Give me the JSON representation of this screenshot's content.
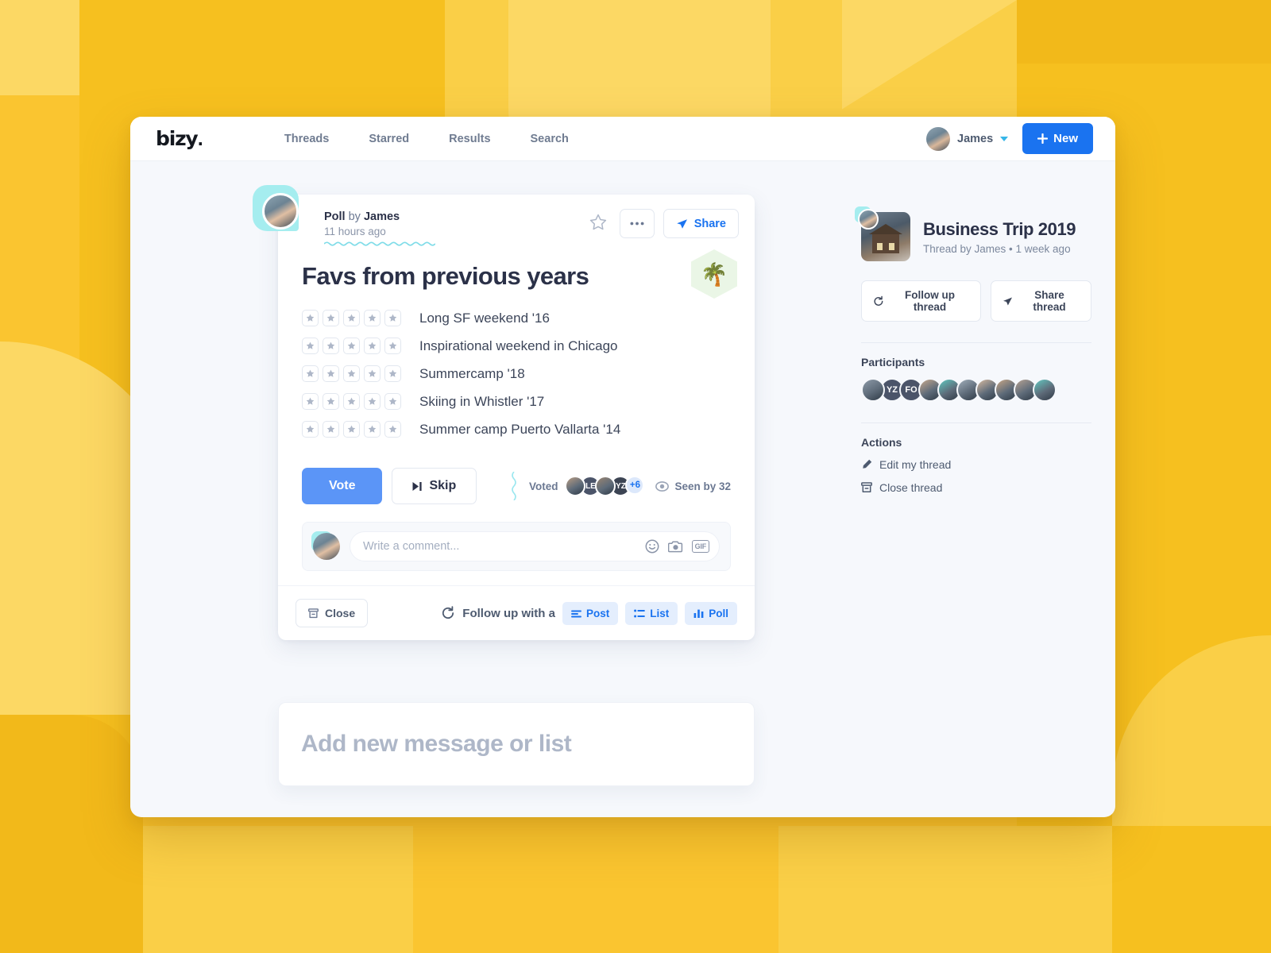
{
  "background": {
    "base_color": "#FAC530",
    "tone_light": "#FCD864",
    "tone_mid": "#FACF47",
    "tone_dark": "#F6C01F",
    "tone_deep": "#F2B91A"
  },
  "topbar": {
    "logo": "bizy",
    "logo_dot": ".",
    "nav": [
      {
        "label": "Threads",
        "name": "nav-threads"
      },
      {
        "label": "Starred",
        "name": "nav-starred"
      },
      {
        "label": "Results",
        "name": "nav-results"
      },
      {
        "label": "Search",
        "name": "nav-search"
      }
    ],
    "user_name": "James",
    "new_button": "New",
    "new_button_icon": "plus-icon",
    "accent_blue": "#1A73F0"
  },
  "poll_card": {
    "byline_type": "Poll",
    "byline_connector": " by ",
    "byline_author": "James",
    "timestamp": "11 hours ago",
    "title": "Favs from previous years",
    "emoji": "🌴",
    "star_icon": "star-outline-icon",
    "more_icon": "ellipsis-icon",
    "share_label": "Share",
    "share_icon": "share-arrow-icon",
    "options": [
      {
        "label": "Long SF weekend '16",
        "stars": 5,
        "rating": 0
      },
      {
        "label": "Inspirational weekend in Chicago",
        "stars": 5,
        "rating": 0
      },
      {
        "label": "Summercamp '18",
        "stars": 5,
        "rating": 0
      },
      {
        "label": "Skiing in Whistler '17",
        "stars": 5,
        "rating": 0
      },
      {
        "label": "Summer camp Puerto Vallarta '14",
        "stars": 5,
        "rating": 0
      }
    ],
    "vote_label": "Vote",
    "skip_label": "Skip",
    "skip_icon": "skip-forward-icon",
    "voted_label": "Voted",
    "voted_avatars": [
      {
        "type": "photo",
        "color": "#B99C82"
      },
      {
        "type": "initials",
        "text": "LE",
        "color": "#4B5469"
      },
      {
        "type": "photo",
        "color": "#9A8571"
      },
      {
        "type": "initials",
        "text": "YZ",
        "color": "#3C4453"
      }
    ],
    "voted_more": "+6",
    "seen_label": "Seen by 32",
    "seen_icon": "eye-icon",
    "comment_placeholder": "Write a comment...",
    "comment_value": "",
    "comment_icons": [
      {
        "name": "emoji-icon",
        "glyph": "☺"
      },
      {
        "name": "camera-icon",
        "glyph": ""
      },
      {
        "name": "gif-icon",
        "glyph": "GIF"
      }
    ],
    "close_label": "Close",
    "close_icon": "archive-box-icon",
    "followup_text": "Follow up with a",
    "followup_icon": "reply-circle-icon",
    "followup_chips": [
      {
        "label": "Post",
        "icon": "post-lines-icon"
      },
      {
        "label": "List",
        "icon": "list-bullets-icon"
      },
      {
        "label": "Poll",
        "icon": "poll-bars-icon"
      }
    ]
  },
  "new_message_card": {
    "placeholder": "Add new message or list"
  },
  "sidebar": {
    "thread_title": "Business Trip 2019",
    "thread_subtitle": "Thread by James  •  1 week ago",
    "follow_up_label": "Follow up thread",
    "follow_up_icon": "reply-circle-icon",
    "share_thread_label": "Share thread",
    "share_thread_icon": "share-arrow-icon",
    "participants_title": "Participants",
    "participants": [
      {
        "type": "photo",
        "color": "#8D9AA8"
      },
      {
        "type": "initials",
        "text": "YZ",
        "color": "#4B5469"
      },
      {
        "type": "initials",
        "text": "FO",
        "color": "#4B5469"
      },
      {
        "type": "photo",
        "color": "#C7A98E"
      },
      {
        "type": "photo",
        "color": "#5FC8C0"
      },
      {
        "type": "photo",
        "color": "#A2AFBB"
      },
      {
        "type": "photo",
        "color": "#D8BBA0"
      },
      {
        "type": "photo",
        "color": "#C9A786"
      },
      {
        "type": "photo",
        "color": "#B8A393"
      },
      {
        "type": "photo",
        "color": "#63C9C2"
      }
    ],
    "actions_title": "Actions",
    "actions": [
      {
        "label": "Edit my thread",
        "icon": "pencil-icon"
      },
      {
        "label": "Close thread",
        "icon": "archive-box-icon"
      }
    ]
  }
}
